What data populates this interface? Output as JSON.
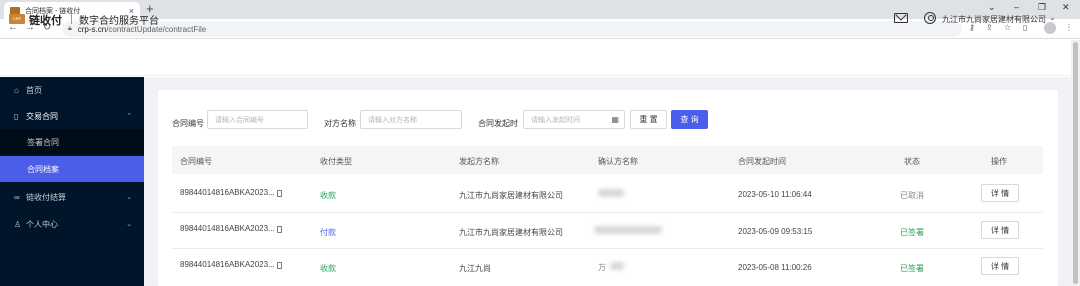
{
  "browser": {
    "tab_title": "合同档案 - 链收付",
    "tab_close": "×",
    "new_tab": "+",
    "url_domain": "crp-s.cn",
    "url_path": "/contractUpdate/contractFile",
    "window_controls": [
      "⌄",
      "–",
      "❐",
      "✕"
    ],
    "toolbar_icons": [
      "key-icon",
      "share-icon",
      "star-icon",
      "sidebar-icon",
      "profile-icon",
      "menu-icon"
    ]
  },
  "header": {
    "logo_text": "CRP",
    "brand": "链收付",
    "platform": "数字合约服务平台",
    "company": "九江市九尚家居建材有限公司"
  },
  "sidebar": {
    "items": [
      {
        "label": "首页",
        "icon": "home-icon"
      },
      {
        "label": "交易合同",
        "icon": "file-icon",
        "expanded": true,
        "children": [
          {
            "label": "签署合同",
            "active": false
          },
          {
            "label": "合同档案",
            "active": true
          }
        ]
      },
      {
        "label": "链收付结算",
        "icon": "link-icon"
      },
      {
        "label": "个人中心",
        "icon": "user-icon"
      }
    ]
  },
  "filters": {
    "contract_no_label": "合同编号",
    "contract_no_placeholder": "请输入合同编号",
    "party_label": "对方名称",
    "party_placeholder": "请输入对方名称",
    "date_label": "合同发起时",
    "date_placeholder": "请输入发起时间",
    "reset_label": "重 置",
    "query_label": "查 询"
  },
  "table": {
    "columns": [
      "合同编号",
      "收付类型",
      "发起方名称",
      "确认方名称",
      "合同发起时间",
      "状态",
      "操作"
    ],
    "rows": [
      {
        "contract_no": "89844014816ABKA2023...",
        "type": "收款",
        "initiator": "九江市九尚家居建材有限公司",
        "confirmer": "",
        "time": "2023-05-10 11:06:44",
        "status": "已取消",
        "action": "详 情"
      },
      {
        "contract_no": "89844014816ABKA2023...",
        "type": "付款",
        "initiator": "九江市九尚家居建材有限公司",
        "confirmer": "",
        "time": "2023-05-09 09:53:15",
        "status": "已签署",
        "action": "详 情"
      },
      {
        "contract_no": "89844014816ABKA2023...",
        "type": "收款",
        "initiator": "九江九尚",
        "confirmer": "万",
        "time": "2023-05-08 11:00:26",
        "status": "已签署",
        "action": "详 情"
      }
    ]
  },
  "colors": {
    "sidebar_bg": "#001529",
    "accent": "#4a5ee9",
    "status_signed": "#2aa05a",
    "status_cancelled": "#888888"
  }
}
